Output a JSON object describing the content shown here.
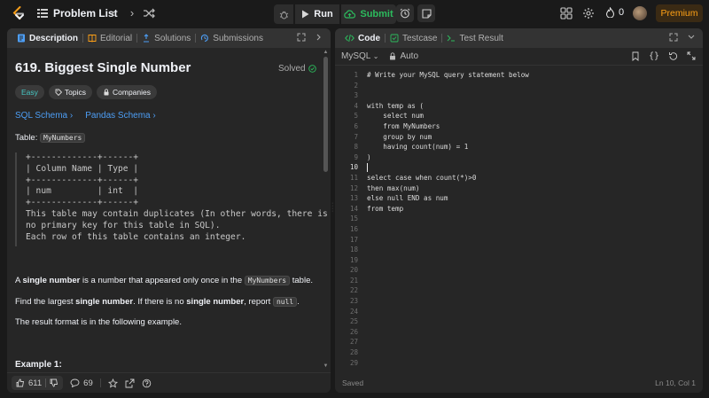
{
  "topbar": {
    "problem_list": "Problem List",
    "run": "Run",
    "submit": "Submit",
    "streak": "0",
    "premium": "Premium"
  },
  "left_tabs": [
    {
      "label": "Description",
      "icon": "description-icon"
    },
    {
      "label": "Editorial",
      "icon": "editorial-icon"
    },
    {
      "label": "Solutions",
      "icon": "solutions-icon"
    },
    {
      "label": "Submissions",
      "icon": "submissions-icon"
    }
  ],
  "problem": {
    "title": "619. Biggest Single Number",
    "status": "Solved",
    "tags": [
      "Easy",
      "Topics",
      "Companies"
    ],
    "schema_links": [
      "SQL Schema",
      "Pandas Schema"
    ],
    "table_label": "Table: ",
    "table_name": "MyNumbers",
    "schema_pre": "+-------------+------+\n| Column Name | Type |\n+-------------+------+\n| num         | int  |\n+-------------+------+\nThis table may contain duplicates (In other words, there is\nno primary key for this table in SQL).\nEach row of this table contains an integer.",
    "p1_a": "A ",
    "p1_b": "single number",
    "p1_c": " is a number that appeared only once in the ",
    "p1_d": "MyNumbers",
    "p1_e": " table.",
    "p2_a": "Find the largest ",
    "p2_b": "single number",
    "p2_c": ". If there is no ",
    "p2_d": "single number",
    "p2_e": ", report ",
    "p2_f": "null",
    "p2_g": ".",
    "p3": "The result format is in the following example.",
    "example": "Example 1:"
  },
  "left_footer": {
    "likes": "611",
    "comments": "69"
  },
  "right_tabs": [
    {
      "label": "Code",
      "icon": "code-icon"
    },
    {
      "label": "Testcase",
      "icon": "testcase-icon"
    },
    {
      "label": "Test Result",
      "icon": "test-result-icon"
    }
  ],
  "editor": {
    "language": "MySQL",
    "mode": "Auto",
    "lines": [
      "# Write your MySQL query statement below",
      "",
      "",
      "with temp as (",
      "    select num",
      "    from MyNumbers",
      "    group by num",
      "    having count(num) = 1",
      ")",
      "",
      "select case when count(*)>0",
      "then max(num)",
      "else null END as num",
      "from temp",
      "",
      "",
      "",
      "",
      "",
      "",
      "",
      "",
      "",
      "",
      "",
      "",
      "",
      "",
      ""
    ],
    "line_numbers": [
      "1",
      "2",
      "3",
      "4",
      "5",
      "6",
      "7",
      "8",
      "9",
      "10",
      "11",
      "12",
      "13",
      "14",
      "15",
      "16",
      "17",
      "18",
      "19",
      "20",
      "21",
      "22",
      "23",
      "24",
      "25",
      "26",
      "27",
      "28",
      "29"
    ],
    "status": "Saved",
    "cursor_pos": "Ln 10, Col 1"
  }
}
